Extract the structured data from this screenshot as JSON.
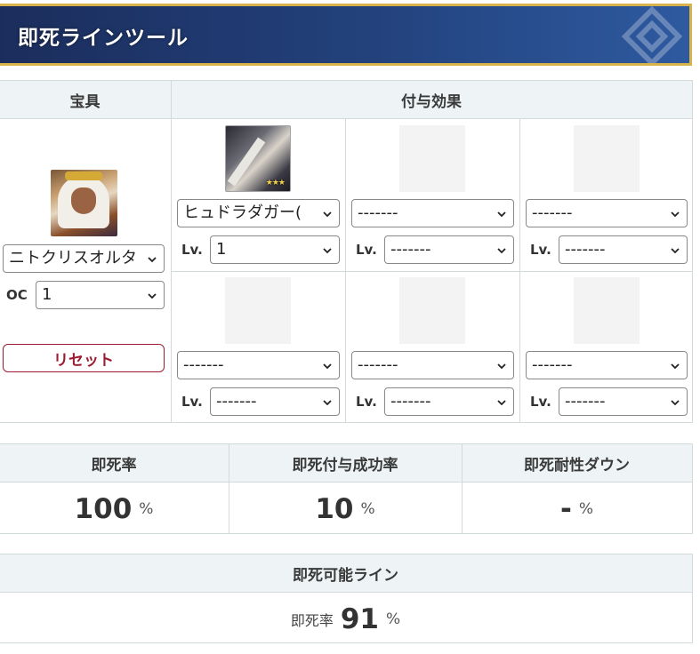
{
  "header": {
    "title": "即死ラインツール"
  },
  "tool": {
    "noble_phantasm_header": "宝具",
    "effects_header": "付与効果",
    "servant": {
      "select_value": "ニトクリスオルタ",
      "oc_label": "OC",
      "oc_value": "1",
      "reset_label": "リセット"
    },
    "effects": [
      {
        "ce": "ヒュドラダガー(",
        "lv_label": "Lv.",
        "lv": "1",
        "has_image": true
      },
      {
        "ce": "-------",
        "lv_label": "Lv.",
        "lv": "-------",
        "has_image": false
      },
      {
        "ce": "-------",
        "lv_label": "Lv.",
        "lv": "-------",
        "has_image": false
      },
      {
        "ce": "-------",
        "lv_label": "Lv.",
        "lv": "-------",
        "has_image": false
      },
      {
        "ce": "-------",
        "lv_label": "Lv.",
        "lv": "-------",
        "has_image": false
      },
      {
        "ce": "-------",
        "lv_label": "Lv.",
        "lv": "-------",
        "has_image": false
      }
    ],
    "ce_stars": "★★★"
  },
  "results": {
    "headers": [
      "即死率",
      "即死付与成功率",
      "即死耐性ダウン"
    ],
    "values": [
      "100",
      "10",
      "-"
    ],
    "unit": "%"
  },
  "line": {
    "header": "即死可能ライン",
    "label": "即死率",
    "value": "91",
    "unit": "%"
  }
}
